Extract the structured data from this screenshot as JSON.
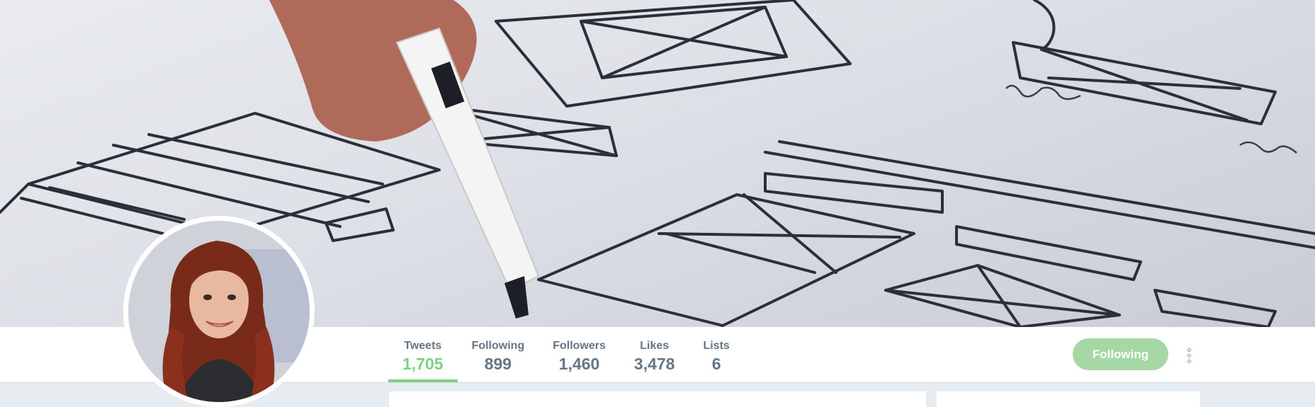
{
  "profile": {
    "banner_description_icon": "banner-wireframe-sketch",
    "avatar_icon": "profile-photo"
  },
  "stats": [
    {
      "label": "Tweets",
      "value": "1,705",
      "active": true
    },
    {
      "label": "Following",
      "value": "899",
      "active": false
    },
    {
      "label": "Followers",
      "value": "1,460",
      "active": false
    },
    {
      "label": "Likes",
      "value": "3,478",
      "active": false
    },
    {
      "label": "Lists",
      "value": "6",
      "active": false
    }
  ],
  "actions": {
    "follow_label": "Following",
    "more_icon": "vertical-ellipsis-icon"
  },
  "colors": {
    "accent": "#7fd180",
    "follow_button": "#a6d8a6",
    "muted_text": "#657786",
    "page_bg": "#e6ecf0"
  }
}
